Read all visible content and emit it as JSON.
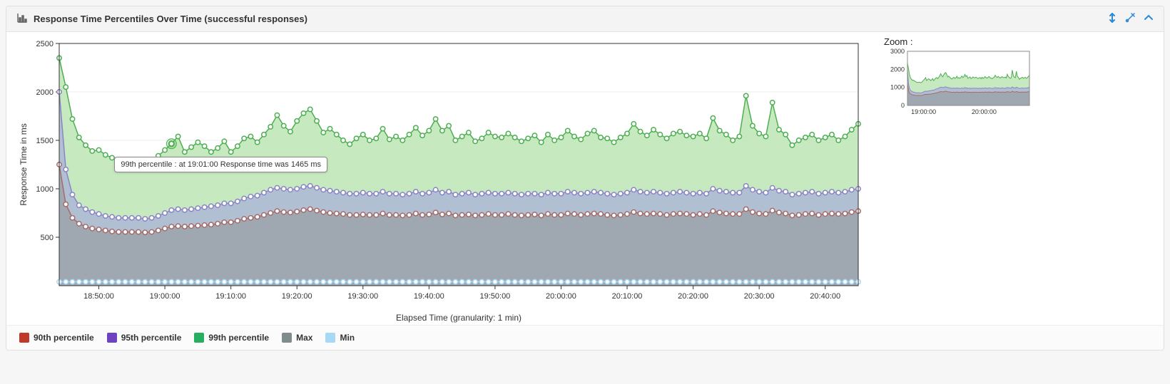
{
  "header": {
    "title": "Response Time Percentiles Over Time (successful responses)"
  },
  "zoom": {
    "label": "Zoom :"
  },
  "chart": {
    "xlabel": "Elapsed Time (granularity: 1 min)",
    "ylabel": "Response Time in ms",
    "ylim": [
      0,
      2500
    ],
    "yticks": [
      500,
      1000,
      1500,
      2000,
      2500
    ],
    "xticks": [
      "18:50:00",
      "19:00:00",
      "19:10:00",
      "19:20:00",
      "19:30:00",
      "19:40:00",
      "19:50:00",
      "20:00:00",
      "20:10:00",
      "20:20:00",
      "20:30:00",
      "20:40:00"
    ]
  },
  "zoom_chart": {
    "yticks": [
      0,
      1000,
      2000,
      3000
    ],
    "xticks": [
      "19:00:00",
      "20:00:00"
    ]
  },
  "tooltip": {
    "text": "99th percentile : at 19:01:00 Response time was 1465 ms"
  },
  "legend": [
    {
      "name": "90th percentile",
      "color": "#c0392b"
    },
    {
      "name": "95th percentile",
      "color": "#6f42c1"
    },
    {
      "name": "99th percentile",
      "color": "#27ae60"
    },
    {
      "name": "Max",
      "color": "#7f8c8d"
    },
    {
      "name": "Min",
      "color": "#a7d8f5"
    }
  ],
  "colors": {
    "p90": "#a56b6b",
    "p95": "#8a84c7",
    "p99": "#4caf50",
    "max": "#9aa0a6",
    "min": "#a7d8f5",
    "fill99": "#b9e3b0",
    "fill95": "#a9b0d8",
    "fill90": "#9aa0a6"
  },
  "chart_data": {
    "type": "area",
    "title": "Response Time Percentiles Over Time (successful responses)",
    "xlabel": "Elapsed Time (granularity: 1 min)",
    "ylabel": "Response Time in ms",
    "ylim": [
      0,
      2500
    ],
    "x": [
      "18:44",
      "18:45",
      "18:46",
      "18:47",
      "18:48",
      "18:49",
      "18:50",
      "18:51",
      "18:52",
      "18:53",
      "18:54",
      "18:55",
      "18:56",
      "18:57",
      "18:58",
      "18:59",
      "19:00",
      "19:01",
      "19:02",
      "19:03",
      "19:04",
      "19:05",
      "19:06",
      "19:07",
      "19:08",
      "19:09",
      "19:10",
      "19:11",
      "19:12",
      "19:13",
      "19:14",
      "19:15",
      "19:16",
      "19:17",
      "19:18",
      "19:19",
      "19:20",
      "19:21",
      "19:22",
      "19:23",
      "19:24",
      "19:25",
      "19:26",
      "19:27",
      "19:28",
      "19:29",
      "19:30",
      "19:31",
      "19:32",
      "19:33",
      "19:34",
      "19:35",
      "19:36",
      "19:37",
      "19:38",
      "19:39",
      "19:40",
      "19:41",
      "19:42",
      "19:43",
      "19:44",
      "19:45",
      "19:46",
      "19:47",
      "19:48",
      "19:49",
      "19:50",
      "19:51",
      "19:52",
      "19:53",
      "19:54",
      "19:55",
      "19:56",
      "19:57",
      "19:58",
      "19:59",
      "20:00",
      "20:01",
      "20:02",
      "20:03",
      "20:04",
      "20:05",
      "20:06",
      "20:07",
      "20:08",
      "20:09",
      "20:10",
      "20:11",
      "20:12",
      "20:13",
      "20:14",
      "20:15",
      "20:16",
      "20:17",
      "20:18",
      "20:19",
      "20:20",
      "20:21",
      "20:22",
      "20:23",
      "20:24",
      "20:25",
      "20:26",
      "20:27",
      "20:28",
      "20:29",
      "20:30",
      "20:31",
      "20:32",
      "20:33",
      "20:34",
      "20:35",
      "20:36",
      "20:37",
      "20:38",
      "20:39",
      "20:40",
      "20:41",
      "20:42",
      "20:43",
      "20:44",
      "20:45"
    ],
    "series": [
      {
        "name": "99th percentile",
        "color": "#4caf50",
        "values": [
          2350,
          2050,
          1720,
          1530,
          1450,
          1390,
          1400,
          1350,
          1320,
          1290,
          1270,
          1290,
          1290,
          1260,
          1280,
          1340,
          1400,
          1465,
          1540,
          1380,
          1430,
          1480,
          1440,
          1380,
          1420,
          1490,
          1380,
          1440,
          1520,
          1540,
          1480,
          1560,
          1640,
          1760,
          1650,
          1590,
          1700,
          1780,
          1820,
          1700,
          1580,
          1620,
          1560,
          1500,
          1460,
          1520,
          1560,
          1500,
          1520,
          1620,
          1510,
          1540,
          1500,
          1560,
          1630,
          1550,
          1600,
          1720,
          1600,
          1650,
          1500,
          1540,
          1580,
          1490,
          1520,
          1580,
          1540,
          1530,
          1570,
          1530,
          1490,
          1520,
          1550,
          1480,
          1560,
          1500,
          1530,
          1600,
          1540,
          1510,
          1570,
          1600,
          1530,
          1520,
          1480,
          1530,
          1570,
          1670,
          1590,
          1550,
          1610,
          1560,
          1520,
          1570,
          1590,
          1550,
          1540,
          1570,
          1520,
          1730,
          1600,
          1560,
          1500,
          1540,
          1960,
          1650,
          1570,
          1540,
          1890,
          1610,
          1560,
          1450,
          1500,
          1530,
          1560,
          1500,
          1530,
          1560,
          1500,
          1540,
          1610,
          1670
        ]
      },
      {
        "name": "95th percentile",
        "color": "#8a84c7",
        "values": [
          2000,
          1200,
          940,
          830,
          790,
          760,
          740,
          720,
          710,
          700,
          700,
          700,
          700,
          690,
          700,
          720,
          750,
          780,
          790,
          780,
          790,
          800,
          810,
          820,
          830,
          850,
          850,
          870,
          900,
          920,
          930,
          960,
          990,
          1010,
          1000,
          990,
          1000,
          1020,
          1030,
          1010,
          990,
          980,
          970,
          960,
          950,
          950,
          960,
          950,
          950,
          970,
          950,
          950,
          940,
          950,
          970,
          950,
          960,
          990,
          960,
          970,
          940,
          950,
          960,
          940,
          950,
          960,
          950,
          950,
          960,
          950,
          940,
          950,
          950,
          940,
          960,
          950,
          950,
          970,
          960,
          950,
          960,
          970,
          960,
          950,
          940,
          950,
          960,
          990,
          970,
          960,
          970,
          960,
          950,
          960,
          970,
          960,
          950,
          960,
          950,
          1000,
          980,
          970,
          960,
          960,
          1030,
          990,
          970,
          960,
          1010,
          980,
          970,
          940,
          950,
          960,
          970,
          950,
          960,
          970,
          960,
          970,
          990,
          1000
        ]
      },
      {
        "name": "90th percentile",
        "color": "#a56b6b",
        "values": [
          1250,
          840,
          700,
          640,
          610,
          590,
          580,
          570,
          560,
          555,
          555,
          555,
          555,
          550,
          555,
          570,
          590,
          610,
          615,
          610,
          615,
          620,
          625,
          630,
          640,
          655,
          655,
          670,
          690,
          700,
          710,
          730,
          750,
          770,
          760,
          755,
          765,
          780,
          790,
          775,
          760,
          750,
          745,
          740,
          730,
          730,
          735,
          730,
          730,
          745,
          730,
          730,
          725,
          730,
          745,
          730,
          735,
          755,
          735,
          745,
          725,
          730,
          735,
          725,
          730,
          740,
          730,
          730,
          740,
          730,
          725,
          730,
          735,
          725,
          740,
          730,
          730,
          745,
          740,
          730,
          740,
          745,
          740,
          730,
          725,
          730,
          740,
          760,
          745,
          740,
          745,
          740,
          730,
          740,
          745,
          740,
          730,
          740,
          730,
          770,
          755,
          745,
          740,
          740,
          790,
          760,
          745,
          740,
          775,
          755,
          745,
          725,
          730,
          740,
          745,
          730,
          740,
          745,
          740,
          745,
          760,
          770
        ]
      },
      {
        "name": "Max",
        "color": "#9aa0a6",
        "values": [
          2350,
          2050,
          1720,
          1530,
          1450,
          1390,
          1400,
          1350,
          1320,
          1290,
          1270,
          1290,
          1290,
          1260,
          1280,
          1340,
          1400,
          1465,
          1540,
          1380,
          1430,
          1480,
          1440,
          1380,
          1420,
          1490,
          1380,
          1440,
          1520,
          1540,
          1480,
          1560,
          1640,
          1760,
          1650,
          1590,
          1700,
          1780,
          1820,
          1700,
          1580,
          1620,
          1560,
          1500,
          1460,
          1520,
          1560,
          1500,
          1520,
          1620,
          1510,
          1540,
          1500,
          1560,
          1630,
          1550,
          1600,
          1720,
          1600,
          1650,
          1500,
          1540,
          1580,
          1490,
          1520,
          1580,
          1540,
          1530,
          1570,
          1530,
          1490,
          1520,
          1550,
          1480,
          1560,
          1500,
          1530,
          1600,
          1540,
          1510,
          1570,
          1600,
          1530,
          1520,
          1480,
          1530,
          1570,
          1670,
          1590,
          1550,
          1610,
          1560,
          1520,
          1570,
          1590,
          1550,
          1540,
          1570,
          1520,
          1730,
          1600,
          1560,
          1500,
          1540,
          1960,
          1650,
          1570,
          1540,
          1890,
          1610,
          1560,
          1450,
          1500,
          1530,
          1560,
          1500,
          1530,
          1560,
          1500,
          1540,
          1610,
          1670
        ]
      },
      {
        "name": "Min",
        "color": "#a7d8f5",
        "values": [
          40,
          40,
          40,
          40,
          40,
          40,
          40,
          40,
          40,
          40,
          40,
          40,
          40,
          40,
          40,
          40,
          40,
          40,
          40,
          40,
          40,
          40,
          40,
          40,
          40,
          40,
          40,
          40,
          40,
          40,
          40,
          40,
          40,
          40,
          40,
          40,
          40,
          40,
          40,
          40,
          40,
          40,
          40,
          40,
          40,
          40,
          40,
          40,
          40,
          40,
          40,
          40,
          40,
          40,
          40,
          40,
          40,
          40,
          40,
          40,
          40,
          40,
          40,
          40,
          40,
          40,
          40,
          40,
          40,
          40,
          40,
          40,
          40,
          40,
          40,
          40,
          40,
          40,
          40,
          40,
          40,
          40,
          40,
          40,
          40,
          40,
          40,
          40,
          40,
          40,
          40,
          40,
          40,
          40,
          40,
          40,
          40,
          40,
          40,
          40,
          40,
          40,
          40,
          40,
          40,
          40,
          40,
          40,
          40,
          40,
          40,
          40,
          40,
          40,
          40,
          40,
          40,
          40,
          40,
          40,
          40,
          40
        ]
      }
    ],
    "tooltip": {
      "series": "99th percentile",
      "x": "19:01:00",
      "value": 1465
    }
  }
}
